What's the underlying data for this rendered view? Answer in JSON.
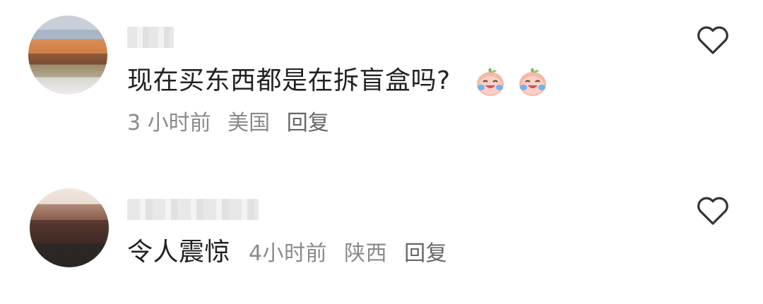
{
  "comments": [
    {
      "text": "现在买东西都是在拆盲盒吗?",
      "emoji": "crying-laughing-peach-emoji",
      "time": "3 小时前",
      "location": "美国",
      "reply": "回复"
    },
    {
      "text": "令人震惊",
      "time": "4小时前",
      "location": "陕西",
      "reply": "回复"
    }
  ],
  "icons": {
    "like": "heart-outline-icon",
    "avatar": "avatar-icon"
  },
  "colors": {
    "text": "#222222",
    "meta": "#8a8a8a",
    "reply": "#666666",
    "background": "#ffffff"
  }
}
